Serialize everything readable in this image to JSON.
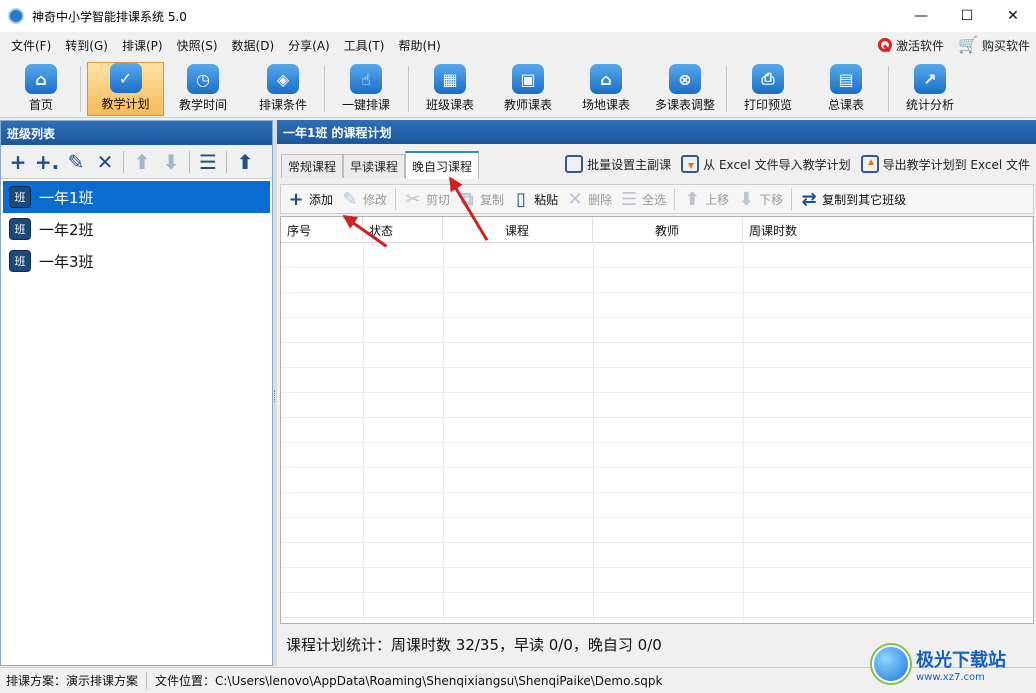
{
  "window": {
    "title": "神奇中小学智能排课系统 5.0",
    "min": "—",
    "max": "☐",
    "close": "✕"
  },
  "menu": {
    "items": [
      "文件(F)",
      "转到(G)",
      "排课(P)",
      "快照(S)",
      "数据(D)",
      "分享(A)",
      "工具(T)",
      "帮助(H)"
    ],
    "activate": "激活软件",
    "buy": "购买软件"
  },
  "toolbar": {
    "items": [
      {
        "label": "首页",
        "icon": "home-icon"
      },
      {
        "label": "教学计划",
        "icon": "clipboard-icon"
      },
      {
        "label": "教学时间",
        "icon": "clock-icon"
      },
      {
        "label": "排课条件",
        "icon": "cubes-icon"
      },
      {
        "label": "一键排课",
        "icon": "hand-click-icon"
      },
      {
        "label": "班级课表",
        "icon": "calendar-grid-icon"
      },
      {
        "label": "教师课表",
        "icon": "teacher-card-icon"
      },
      {
        "label": "场地课表",
        "icon": "building-icon"
      },
      {
        "label": "多课表调整",
        "icon": "multi-schedule-icon"
      },
      {
        "label": "打印预览",
        "icon": "printer-icon"
      },
      {
        "label": "总课表",
        "icon": "summary-calendar-icon"
      },
      {
        "label": "统计分析",
        "icon": "chart-icon"
      }
    ],
    "active_index": 1
  },
  "left": {
    "title": "班级列表",
    "classes": [
      {
        "name": "一年1班",
        "icon_text": "班"
      },
      {
        "name": "一年2班",
        "icon_text": "班"
      },
      {
        "name": "一年3班",
        "icon_text": "班"
      }
    ],
    "selected_index": 0
  },
  "right": {
    "title": "一年1班 的课程计划",
    "tabs": [
      "常规课程",
      "早读课程",
      "晚自习课程"
    ],
    "active_tab": 2,
    "actions": {
      "batch": "批量设置主副课",
      "import": "从 Excel 文件导入教学计划",
      "export": "导出教学计划到 Excel 文件"
    },
    "subtools": {
      "add": "添加",
      "edit": "修改",
      "cut": "剪切",
      "copy": "复制",
      "paste": "粘贴",
      "delete": "删除",
      "select_all": "全选",
      "move_up": "上移",
      "move_down": "下移",
      "copy_to": "复制到其它班级"
    },
    "columns": [
      "序号",
      "状态",
      "课程",
      "教师",
      "周课时数"
    ],
    "stats": "课程计划统计：周课时数 32/35，早读 0/0，晚自习 0/0"
  },
  "status": {
    "scheme_label": "排课方案：演示排课方案",
    "file_label": "文件位置：C:\\Users\\lenovo\\AppData\\Roaming\\Shenqixiangsu\\ShenqiPaike\\Demo.sqpk"
  },
  "watermark": {
    "name": "极光下载站",
    "url": "www.xz7.com"
  },
  "colors": {
    "header_blue": "#1c579b",
    "selection_blue": "#0a6cd1",
    "active_orange": "#f7b955",
    "arrow_red": "#d21f1f"
  }
}
